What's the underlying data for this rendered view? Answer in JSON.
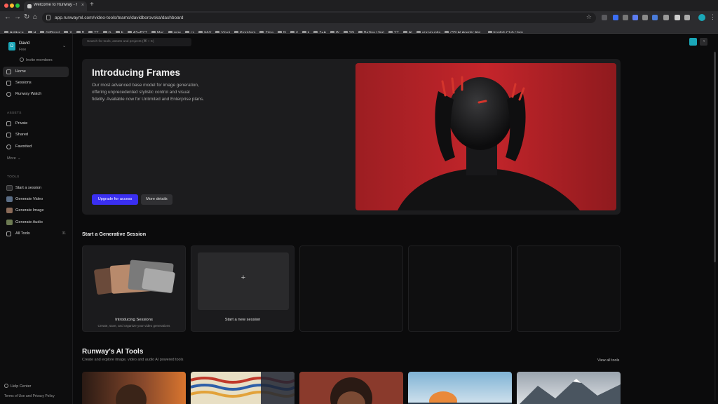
{
  "browser": {
    "tab_title": "Welcome to Runway - Runw...",
    "url": "app.runwayml.com/video-tools/teams/davidborovska/dashboard",
    "bookmarks": [
      "Aplikace",
      "H",
      "GitBoost",
      "X",
      "B",
      "TT",
      "G",
      "F",
      "AS+BYT",
      "Mac",
      "rege",
      "cs",
      "F&V",
      "Vývoj",
      "Prorážem",
      "Zima",
      "N",
      "d",
      "k",
      "Z+A",
      "W",
      "SN",
      "Bažina (Jira)",
      "YT",
      "AI",
      "ai komunita",
      "(33) AI Agentic Rej...",
      "English Club (Jarn..."
    ]
  },
  "colors": {
    "accent_teal": "#1aa7b8",
    "primary_button": "#3a2ff2",
    "hero_bg": "#c4252b"
  },
  "workspace": {
    "avatar_letter": "D",
    "name": "David",
    "plan": "Free",
    "invite": "Invite members"
  },
  "nav": {
    "home": "Home",
    "sessions": "Sessions",
    "watch": "Runway Watch"
  },
  "assets": {
    "heading": "ASSETS",
    "private": "Private",
    "shared": "Shared",
    "favorited": "Favorited",
    "more": "More"
  },
  "tools": {
    "heading": "TOOLS",
    "start_session": "Start a session",
    "gen_video": "Generate Video",
    "gen_image": "Generate Image",
    "gen_audio": "Generate Audio",
    "all_tools": "All Tools",
    "all_tools_count": "31"
  },
  "footer": {
    "help": "Help Center",
    "terms": "Terms of Use and Privacy Policy"
  },
  "search": {
    "placeholder": "Search for tools, assets and projects (⌘ + K)"
  },
  "hero": {
    "title": "Introducing Frames",
    "description": "Our most advanced base model for image generation, offering unprecedented stylistic control and visual fidelity. Available now for Unlimited and Enterprise plans.",
    "upgrade": "Upgrade for access",
    "more": "More details"
  },
  "sessions": {
    "title": "Start a Generative Session",
    "card1_title": "Introducing Sessions",
    "card1_sub": "Create, save, and organize your video generations",
    "card2_title": "Start a new session",
    "plus": "+"
  },
  "ai_tools": {
    "title": "Runway's AI Tools",
    "subtitle": "Create and explore image, video and audio AI powered tools",
    "view_all": "View all tools"
  }
}
